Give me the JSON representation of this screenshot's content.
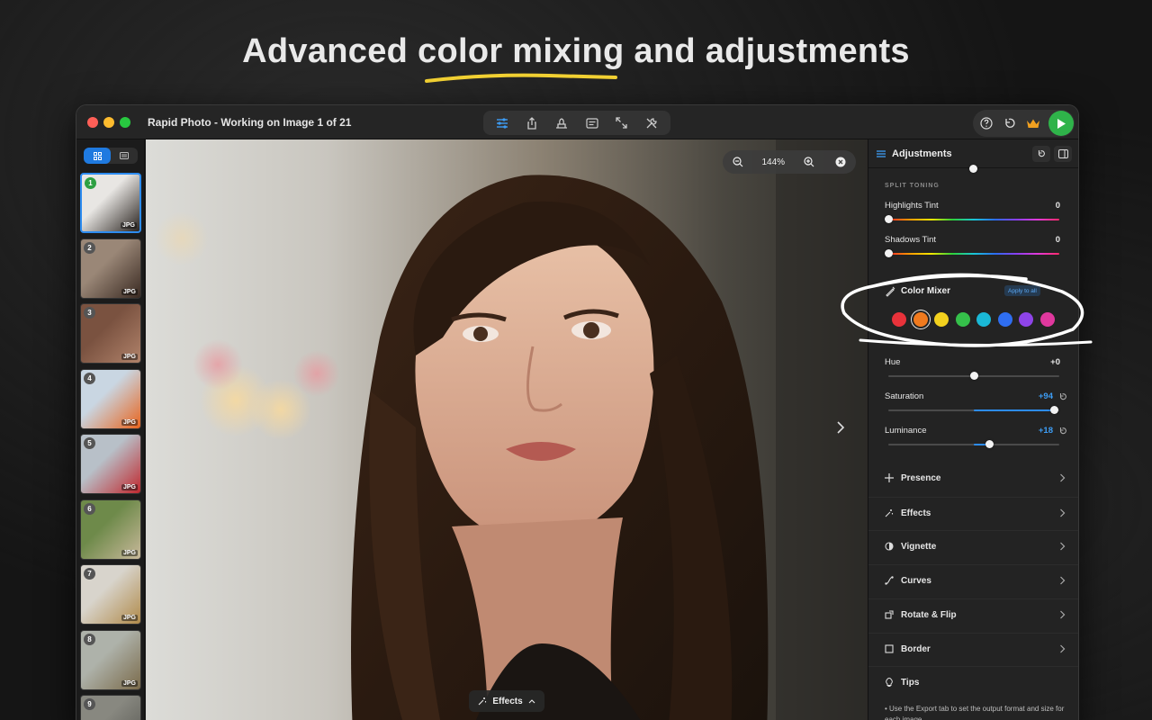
{
  "headline": "Advanced color mixing and adjustments",
  "window": {
    "title": "Rapid Photo - Working on Image 1 of 21"
  },
  "thumbnails": [
    {
      "num": "1",
      "badge": "JPG",
      "colors": [
        "#e8e6e3",
        "#2a2420"
      ]
    },
    {
      "num": "2",
      "badge": "JPG",
      "colors": [
        "#9a8777",
        "#3a2a22"
      ]
    },
    {
      "num": "3",
      "badge": "JPG",
      "colors": [
        "#7a5240",
        "#b0826a"
      ]
    },
    {
      "num": "4",
      "badge": "JPG",
      "colors": [
        "#c9d6e2",
        "#e8641e"
      ]
    },
    {
      "num": "5",
      "badge": "JPG",
      "colors": [
        "#b8c0c8",
        "#c0282e"
      ]
    },
    {
      "num": "6",
      "badge": "JPG",
      "colors": [
        "#6e8a4a",
        "#c8b89a"
      ]
    },
    {
      "num": "7",
      "badge": "JPG",
      "colors": [
        "#d8d4cc",
        "#b08a4a"
      ]
    },
    {
      "num": "8",
      "badge": "JPG",
      "colors": [
        "#aeb2aa",
        "#7a6a4a"
      ]
    },
    {
      "num": "9",
      "badge": "",
      "colors": [
        "#888880",
        "#555550"
      ]
    }
  ],
  "canvas": {
    "zoom": "144%",
    "effects_label": "Effects"
  },
  "panel": {
    "title": "Adjustments",
    "split_toning": {
      "section": "SPLIT TONING",
      "highlights": {
        "label": "Highlights Tint",
        "value": "0",
        "position": 0
      },
      "shadows": {
        "label": "Shadows Tint",
        "value": "0",
        "position": 0
      }
    },
    "color_mixer": {
      "label": "Color Mixer",
      "apply_chip": "Apply to all",
      "swatches": [
        "#e8323a",
        "#f07a1e",
        "#f3d11e",
        "#35c04a",
        "#1ab8d6",
        "#2f6ef0",
        "#8e44e8",
        "#e0389e"
      ],
      "selected_swatch": 1
    },
    "hue": {
      "label": "Hue",
      "value": "+0",
      "position": 0.5
    },
    "saturation": {
      "label": "Saturation",
      "value": "+94",
      "position": 0.97
    },
    "luminance": {
      "label": "Luminance",
      "value": "+18",
      "position": 0.59
    },
    "sections": [
      {
        "label": "Presence",
        "icon": "sparkle-icon"
      },
      {
        "label": "Effects",
        "icon": "magic-wand-icon"
      },
      {
        "label": "Vignette",
        "icon": "vignette-icon"
      },
      {
        "label": "Curves",
        "icon": "curves-icon"
      },
      {
        "label": "Rotate & Flip",
        "icon": "rotate-icon"
      },
      {
        "label": "Border",
        "icon": "border-icon"
      },
      {
        "label": "Tips",
        "icon": "lightbulb-icon"
      }
    ],
    "tips_text": "• Use the Export tab to set the output format and size for each image"
  },
  "colors": {
    "accent": "#2d8cf0",
    "play": "#2fb34a",
    "crown": "#f0a020"
  }
}
